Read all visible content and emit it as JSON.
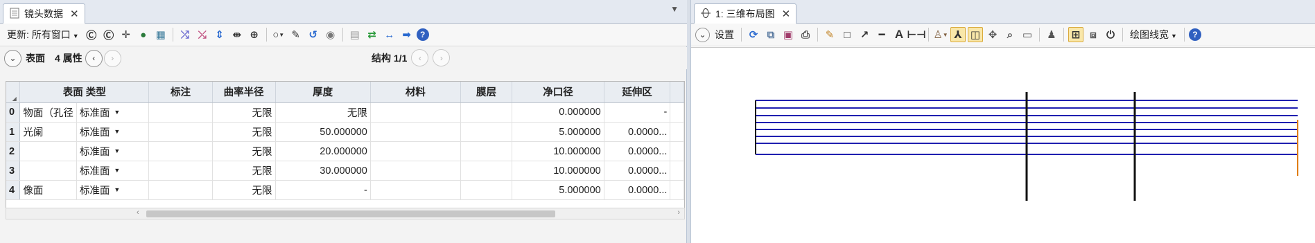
{
  "lens_data_window": {
    "tab_title": "镜头数据",
    "toolbar": {
      "update_label": "更新: 所有窗口",
      "icons": [
        "refresh-icon",
        "refresh-all-icon",
        "crosshair-icon",
        "globe-icon",
        "map-icon",
        "split-icon",
        "merge-icon",
        "arrows-v-icon",
        "arrows-h-icon",
        "arrows-cross-icon",
        "circle-icon",
        "brush-icon",
        "wrap-icon",
        "toggle-icon",
        "page-icon",
        "swap-icon",
        "exchange-icon",
        "arrow-right-icon",
        "help-icon"
      ]
    },
    "surface_bar": {
      "surface_label": "表面",
      "properties_label": "4 属性",
      "config_label": "结构 1/1"
    },
    "columns": [
      "表面 类型",
      "标注",
      "曲率半径",
      "厚度",
      "材料",
      "膜层",
      "净口径",
      "延伸区"
    ],
    "rows": [
      {
        "index": "0",
        "name": "物面（孔径",
        "type": "标准面",
        "comment": "",
        "radius": "无限",
        "thickness": "无限",
        "material": "",
        "coating": "",
        "clear_semi_dia": "0.000000",
        "chip_zone": "-"
      },
      {
        "index": "1",
        "name": "光阑",
        "type": "标准面",
        "comment": "",
        "radius": "无限",
        "thickness": "50.000000",
        "material": "",
        "coating": "",
        "clear_semi_dia": "5.000000",
        "chip_zone": "0.0000..."
      },
      {
        "index": "2",
        "name": "",
        "type": "标准面",
        "comment": "",
        "radius": "无限",
        "thickness": "20.000000",
        "material": "",
        "coating": "",
        "clear_semi_dia": "10.000000",
        "chip_zone": "0.0000..."
      },
      {
        "index": "3",
        "name": "",
        "type": "标准面",
        "comment": "",
        "radius": "无限",
        "thickness": "30.000000",
        "material": "",
        "coating": "",
        "clear_semi_dia": "10.000000",
        "chip_zone": "0.0000..."
      },
      {
        "index": "4",
        "name": "像面",
        "type": "标准面",
        "comment": "",
        "radius": "无限",
        "thickness": "-",
        "material": "",
        "coating": "",
        "clear_semi_dia": "5.000000",
        "chip_zone": "0.0000..."
      }
    ]
  },
  "layout_window": {
    "tab_title": "1: 三维布局图",
    "toolbar": {
      "settings_label": "设置",
      "line_width_label": "绘图线宽",
      "icons": [
        "refresh-icon",
        "copy-icon",
        "save-icon",
        "print-icon",
        "pencil-icon",
        "rectangle-icon",
        "arrow-line-icon",
        "line-icon",
        "text-icon",
        "dimension-icon",
        "draw-options-icon",
        "axes-icon",
        "view-icon",
        "move-icon",
        "zoom-icon",
        "image-icon",
        "person-icon",
        "fit-icon",
        "window-icon",
        "power-icon",
        "help-icon"
      ]
    },
    "colors": {
      "ray": "#1f1fb0",
      "surface": "#111111",
      "image_edge": "#e07d10"
    }
  }
}
